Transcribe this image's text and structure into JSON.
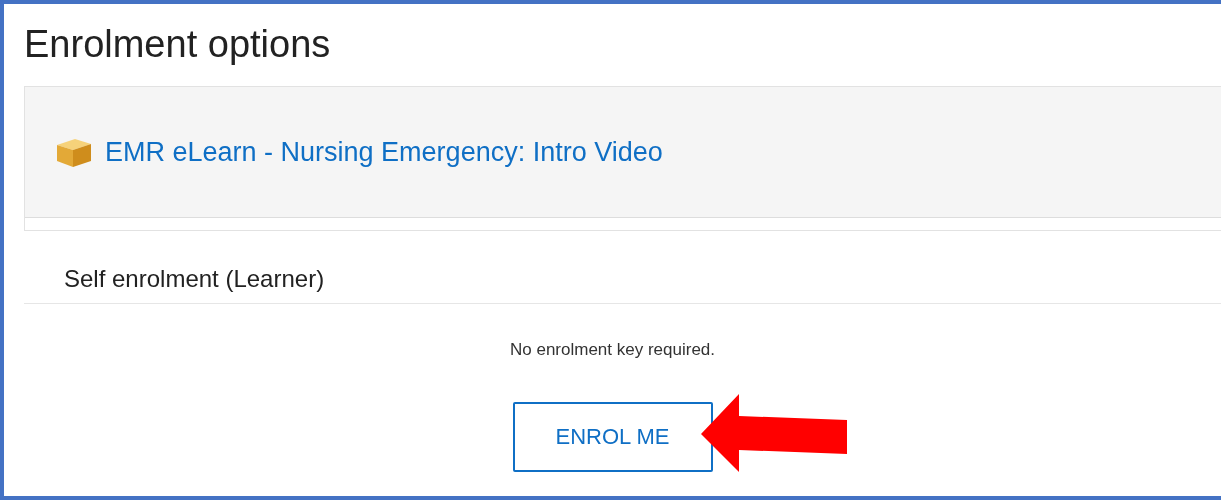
{
  "page": {
    "title": "Enrolment options"
  },
  "course": {
    "name": "EMR eLearn - Nursing Emergency: Intro Video"
  },
  "section": {
    "title": "Self enrolment (Learner)",
    "message": "No enrolment key required.",
    "button": "ENROL ME"
  }
}
